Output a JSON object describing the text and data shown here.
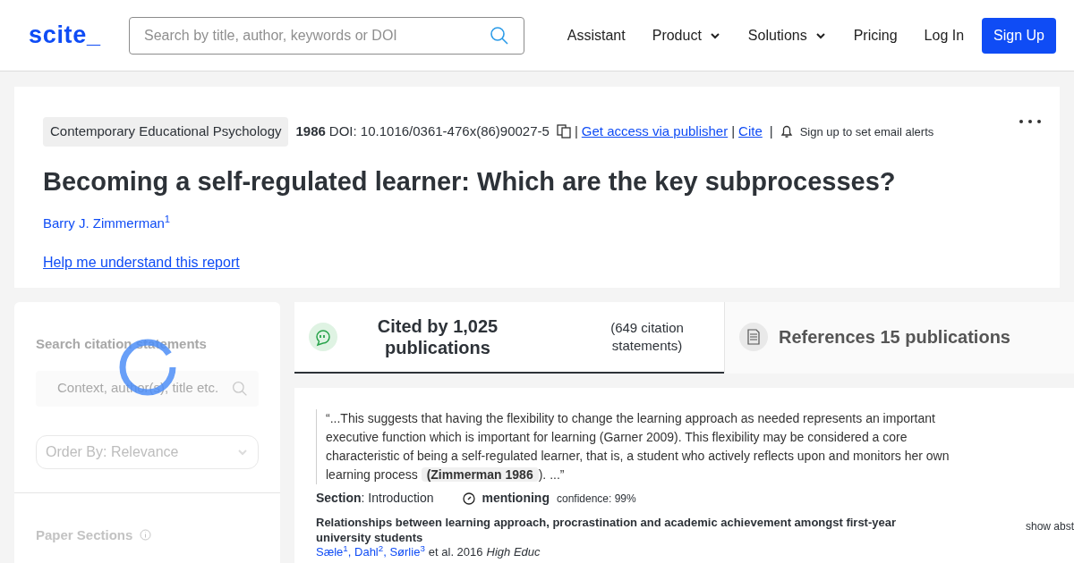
{
  "header": {
    "logo": "scite_",
    "search": {
      "placeholder": "Search by title, author, keywords or DOI"
    },
    "nav": [
      {
        "label": "Assistant",
        "dropdown": false
      },
      {
        "label": "Product",
        "dropdown": true
      },
      {
        "label": "Solutions",
        "dropdown": true
      },
      {
        "label": "Pricing",
        "dropdown": false
      },
      {
        "label": "Log In",
        "dropdown": false
      }
    ],
    "signup": "Sign Up"
  },
  "paper": {
    "journal": "Contemporary Educational Psychology",
    "year": "1986",
    "doi": "DOI: 10.1016/0361-476x(86)90027-5",
    "separators": [
      "|",
      "|",
      "|"
    ],
    "access": "Get access via publisher",
    "cite": "Cite",
    "alerts": "Sign up to set email alerts",
    "title": "Becoming a self-regulated learner: Which are the key subprocesses?",
    "authors": [
      {
        "name": "Barry J. Zimmerman",
        "sup": "1"
      }
    ],
    "help": "Help me understand this report"
  },
  "sidebar": {
    "search_label": "Search citation statements",
    "search": {
      "placeholder": "Context, author(s), title etc."
    },
    "order": "Order By: Relevance",
    "sections_label": "Paper Sections",
    "loading": true
  },
  "tabs": [
    {
      "kind": "cited",
      "title": "Cited by 1,025 publications",
      "subtitle": "(649 citation statements)",
      "selected": true
    },
    {
      "kind": "references",
      "title": "References 15 publications",
      "selected": false
    }
  ],
  "citation": {
    "quote_before": "“...This suggests that having the flexibility to change the learning approach as needed represents an important executive function which is important for learning (Garner 2009). This flexibility may be considered a core characteristic of being a self-regulated learner, that is, a student who actively reflects upon and monitors her own learning process",
    "highlight": "(Zimmerman 1986",
    "quote_after": "). ...”",
    "section": "**Section**: Introduction",
    "type": "mentioning",
    "confidence": "confidence: 99%",
    "title": "Relationships between learning approach, procrastination and academic achievement amongst first-year university students",
    "authors": "Sæle$^{1}$, Dahl$^{2}$, Sørlie$^{3}$",
    "meta": "et al. 2016",
    "journal": "High Educ",
    "show": "show abst"
  }
}
